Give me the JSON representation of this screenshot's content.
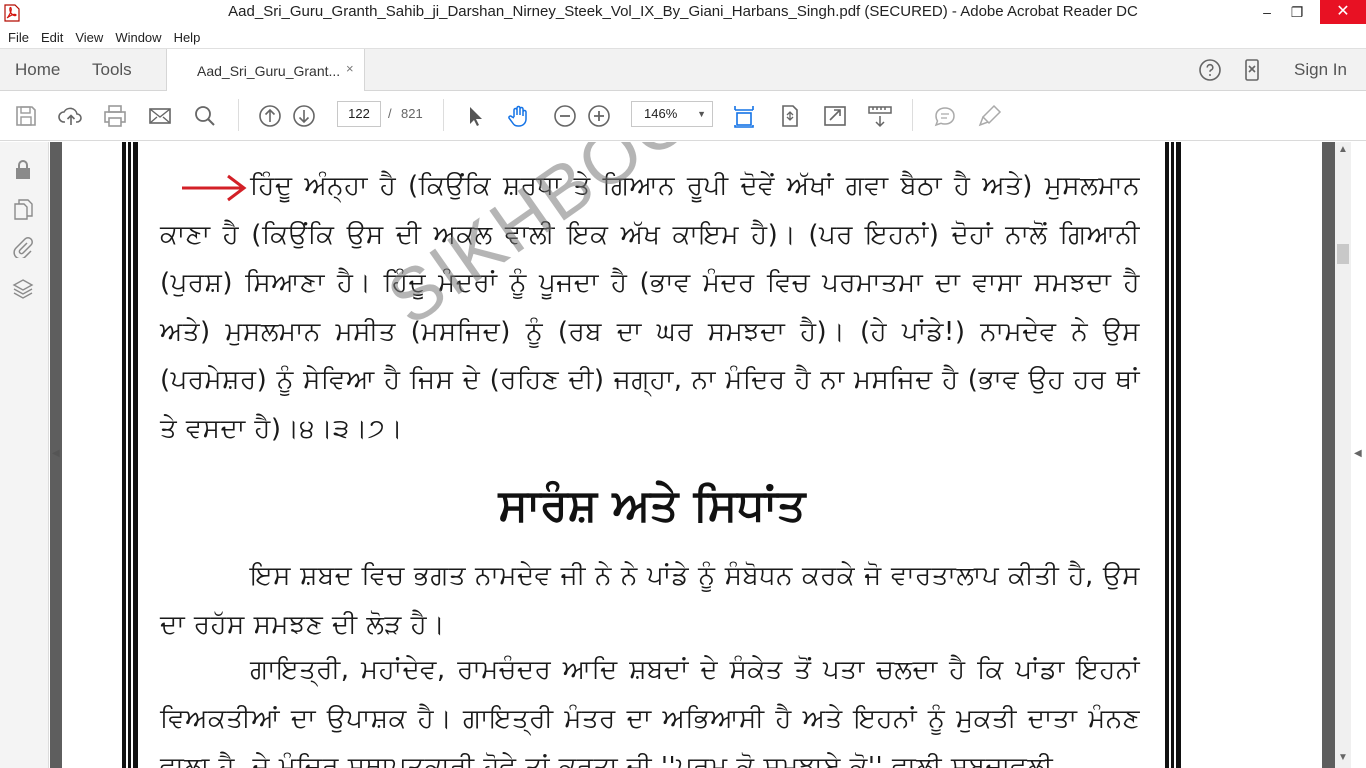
{
  "window": {
    "title": "Aad_Sri_Guru_Granth_Sahib_ji_Darshan_Nirney_Steek_Vol_IX_By_Giani_Harbans_Singh.pdf (SECURED) - Adobe Acrobat Reader DC",
    "minimize": "–",
    "maximize": "❐",
    "close": "✕"
  },
  "menu": [
    "File",
    "Edit",
    "View",
    "Window",
    "Help"
  ],
  "tabs": {
    "home": "Home",
    "tools": "Tools",
    "document": "Aad_Sri_Guru_Grant...",
    "close": "×",
    "signin": "Sign In"
  },
  "toolbar": {
    "page_current": "122",
    "page_separator": "/",
    "page_total": "821",
    "zoom": "146%",
    "zoom_caret": "▼"
  },
  "document": {
    "watermark": "SIKHBOOKCLUB.",
    "paragraph1": "ਹਿੰਦੂ ਅੰਨ੍ਹਾ ਹੈ (ਕਿਉਂਕਿ ਸ਼ਰਧਾ ਤੇ ਗਿਆਨ ਰੂਪੀ ਦੋਵੇਂ ਅੱਖਾਂ ਗਵਾ ਬੈਠਾ ਹੈ ਅਤੇ) ਮੁਸਲਮਾਨ ਕਾਣਾ ਹੈ (ਕਿਉਂਕਿ ਉਸ ਦੀ ਅਕਲ ਵਾਲੀ ਇਕ ਅੱਖ ਕਾਇਮ ਹੈ)। (ਪਰ ਇਹਨਾਂ) ਦੋਹਾਂ ਨਾਲੋਂ ਗਿਆਨੀ (ਪੁਰਸ਼) ਸਿਆਣਾ ਹੈ। ਹਿੰਦੂ ਮੰਦਰਾਂ ਨੂੰ ਪੂਜਦਾ ਹੈ (ਭਾਵ ਮੰਦਰ ਵਿਚ ਪਰਮਾਤਮਾ ਦਾ ਵਾਸਾ ਸਮਝਦਾ ਹੈ ਅਤੇ) ਮੁਸਲਮਾਨ ਮਸੀਤ (ਮਸਜਿਦ) ਨੂੰ (ਰਬ ਦਾ ਘਰ ਸਮਝਦਾ ਹੈ)। (ਹੇ ਪਾਂਡੇ!) ਨਾਮਦੇਵ ਨੇ ਉਸ (ਪਰਮੇਸ਼ਰ) ਨੂੰ ਸੇਵਿਆ ਹੈ ਜਿਸ ਦੇ (ਰਹਿਣ ਦੀ) ਜਗ੍ਹਾ, ਨਾ ਮੰਦਿਰ ਹੈ ਨਾ ਮਸਜਿਦ ਹੈ (ਭਾਵ ਉਹ ਹਰ ਥਾਂ ਤੇ ਵਸਦਾ ਹੈ)।੪।੩।੭।",
    "heading": "ਸਾਰੰਸ਼ ਅਤੇ ਸਿਧਾਂਤ",
    "paragraph2": "ਇਸ ਸ਼ਬਦ ਵਿਚ ਭਗਤ ਨਾਮਦੇਵ ਜੀ ਨੇ ਨੇ ਪਾਂਡੇ ਨੂੰ ਸੰਬੋਧਨ ਕਰਕੇ ਜੋ ਵਾਰਤਾਲਾਪ ਕੀਤੀ ਹੈ, ਉਸ ਦਾ ਰਹੱਸ ਸਮਝਣ ਦੀ ਲੋੜ ਹੈ।",
    "paragraph3": "ਗਾਇਤ੍ਰੀ, ਮਹਾਂਦੇਵ, ਰਾਮਚੰਦਰ ਆਦਿ ਸ਼ਬਦਾਂ ਦੇ ਸੰਕੇਤ ਤੋਂ ਪਤਾ ਚਲਦਾ ਹੈ ਕਿ ਪਾਂਡਾ ਇਹਨਾਂ ਵਿਅਕਤੀਆਂ ਦਾ ਉਪਾਸ਼ਕ ਹੈ। ਗਾਇਤ੍ਰੀ ਮੰਤਰ ਦਾ ਅਭਿਆਸੀ ਹੈ ਅਤੇ ਇਹਨਾਂ ਨੂੰ ਮੁਕਤੀ ਦਾਤਾ ਮੰਨਣ ਵਾਲਾ ਹੈ, ਜੇ ਮੰਦਿਰ ਸਥਾਪਤਕਾਰੀ ਹੋਵੇ ਤਾਂ ਕਰਤਾ ਜੀ ''ਪਰਮ ਕੋ ਸਮਝਾਏ ਕੋ'' ਵਾਲੀ ਸ਼ਬਦਾਵਲੀ"
  },
  "colors": {
    "close_button": "#e81123",
    "active_tool": "#1473e6",
    "annotation_arrow": "#d32027"
  }
}
